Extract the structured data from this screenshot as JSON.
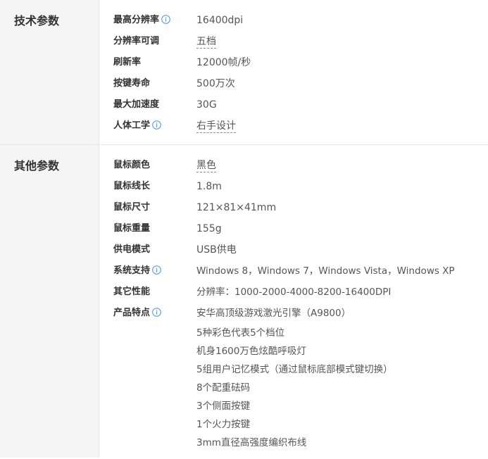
{
  "sections": [
    {
      "title": "技术参数",
      "rows": [
        {
          "label": "最高分辨率",
          "info": true,
          "value": "16400dpi",
          "dashed": false
        },
        {
          "label": "分辨率可调",
          "info": false,
          "value": "五档",
          "dashed": true
        },
        {
          "label": "刷新率",
          "info": false,
          "value": "12000帧/秒",
          "dashed": false
        },
        {
          "label": "按键寿命",
          "info": false,
          "value": "500万次",
          "dashed": false
        },
        {
          "label": "最大加速度",
          "info": false,
          "value": "30G",
          "dashed": false
        },
        {
          "label": "人体工学",
          "info": true,
          "value": "右手设计",
          "dashed": true
        }
      ]
    },
    {
      "title": "其他参数",
      "rows": [
        {
          "label": "鼠标颜色",
          "info": false,
          "value": "黑色",
          "dashed": true
        },
        {
          "label": "鼠标线长",
          "info": false,
          "value": "1.8m",
          "dashed": false
        },
        {
          "label": "鼠标尺寸",
          "info": false,
          "value": "121×81×41mm",
          "dashed": false
        },
        {
          "label": "鼠标重量",
          "info": false,
          "value": "155g",
          "dashed": false
        },
        {
          "label": "供电模式",
          "info": false,
          "value": "USB供电",
          "dashed": false
        },
        {
          "label": "系统支持",
          "info": true,
          "value": "Windows 8，Windows 7，Windows Vista，Windows XP",
          "dashed": false
        },
        {
          "label": "其它性能",
          "info": false,
          "value": "分辨率：1000-2000-4000-8200-16400DPI",
          "dashed": false
        }
      ],
      "features": {
        "label": "产品特点",
        "info": true,
        "items": [
          "安华高顶级游戏激光引擎（A9800）",
          "5种彩色代表5个档位",
          "机身1600万色炫酷呼吸灯",
          "5组用户记忆模式（通过鼠标底部模式键切换）",
          "8个配重砝码",
          "3个侧面按键",
          "1个火力按键",
          "3mm直径高强度编织布线"
        ]
      }
    }
  ],
  "colors": {
    "sidebar_bg": "#f5f5f5",
    "border": "#e6e6e6",
    "info_icon": "#4a90e2",
    "label_text": "#333333",
    "value_text": "#555555"
  },
  "icons": {
    "info": "info-circle-icon"
  }
}
